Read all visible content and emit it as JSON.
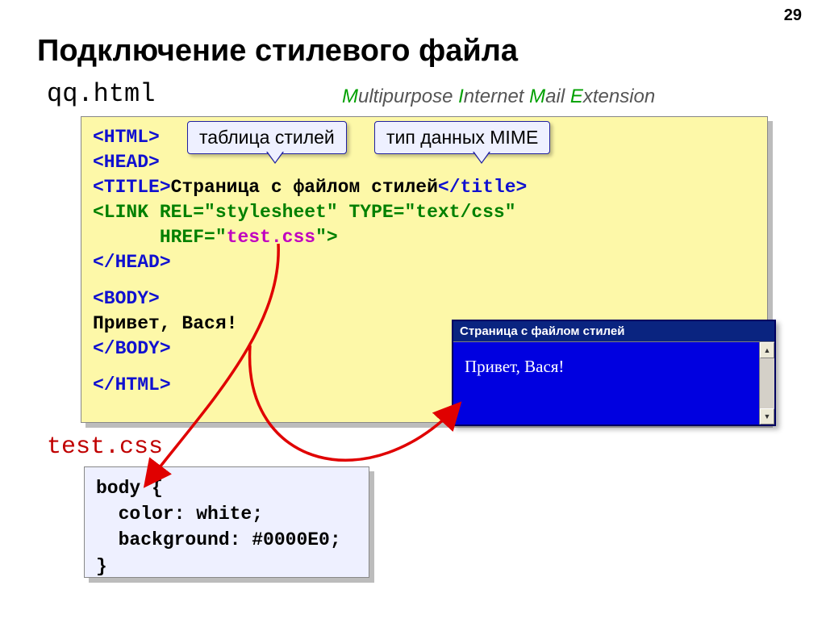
{
  "pageNumber": "29",
  "title": "Подключение стилевого файла",
  "filenameHtml": "qq.html",
  "mime": {
    "m": "M",
    "m2": "ultipurpose ",
    "i": "I",
    "i2": "nternet ",
    "ma": "M",
    "ma2": "ail ",
    "e": "E",
    "e2": "xtension"
  },
  "callout1": "таблица стилей",
  "callout2": "тип данных MIME",
  "code": {
    "l1a": "<HTML>",
    "l2a": "<HEAD>",
    "l3a": "<TITLE>",
    "l3b": "Страница с файлом стилей",
    "l3c": "</title>",
    "l4a": "<LINK REL=",
    "l4b": "\"stylesheet\"",
    "l4c": " TYPE=",
    "l4d": "\"text/css\"",
    "l5a": "      HREF=",
    "l5b": "\"",
    "l5c": "test.css",
    "l5d": "\"",
    "l5e": ">",
    "l6a": "</HEAD>",
    "l7a": "<BODY>",
    "l8a": "Привет, Вася!",
    "l9a": "</BODY>",
    "l10a": "</HTML>"
  },
  "filenameCss": "test.css",
  "css": {
    "l1": "body {",
    "l2": "  color: white;",
    "l3": "  background: #0000E0;",
    "l4": "}"
  },
  "browser": {
    "title": "Страница с файлом стилей",
    "body": "Привет, Вася!"
  }
}
